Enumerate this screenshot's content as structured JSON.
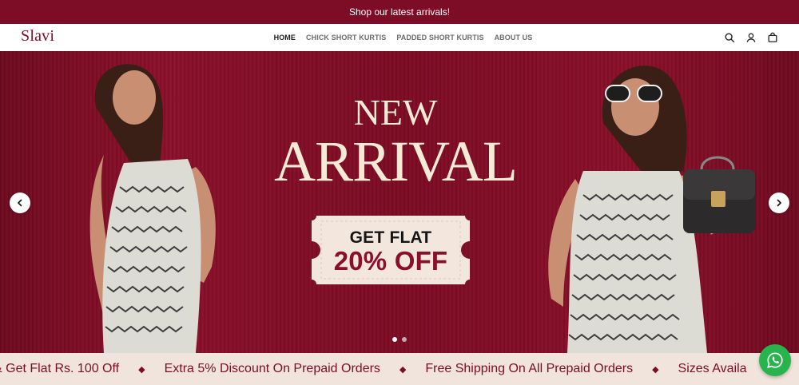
{
  "announcement": {
    "text": "Shop our latest arrivals!"
  },
  "header": {
    "logo": "Slavi",
    "nav": [
      {
        "label": "HOME",
        "active": true
      },
      {
        "label": "CHICK SHORT KURTIS",
        "active": false
      },
      {
        "label": "PADDED SHORT KURTIS",
        "active": false
      },
      {
        "label": "ABOUT US",
        "active": false
      }
    ],
    "icons": [
      "search-icon",
      "account-icon",
      "cart-icon"
    ]
  },
  "hero": {
    "headline_top": "NEW",
    "headline_bottom": "ARRIVAL",
    "offer_line1": "GET FLAT",
    "offer_line2": "20% OFF",
    "slides_total": 2,
    "active_slide": 1,
    "colors": {
      "background": "#7d0c26",
      "headline": "#f5ead6",
      "offer_accent": "#8a0f2a",
      "ticket": "#f3e7dd"
    }
  },
  "marquee": {
    "items": [
      "& Get Flat Rs. 100 Off",
      "Extra 5% Discount On Prepaid Orders",
      "Free Shipping On All Prepaid Orders",
      "Sizes Availa"
    ],
    "separator": "◆"
  },
  "whatsapp": {
    "icon": "whatsapp-icon",
    "color": "#28b44c"
  }
}
